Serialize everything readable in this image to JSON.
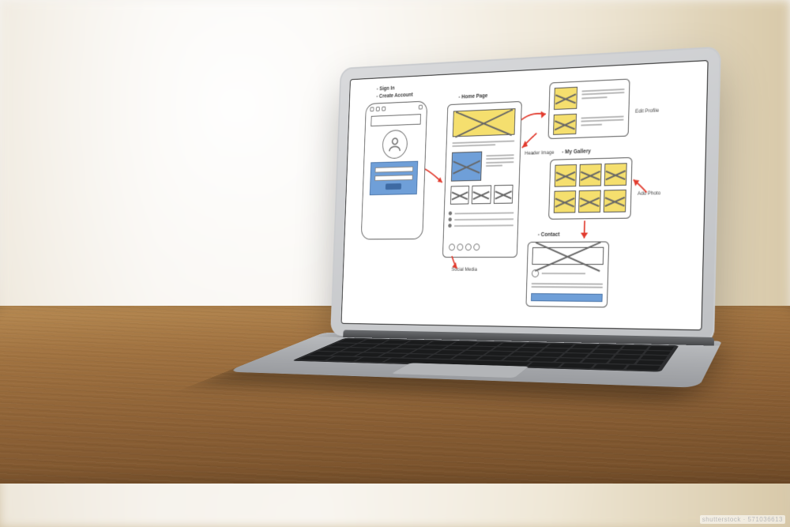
{
  "watermark": "shutterstock · 571036613",
  "wireframe": {
    "signin": {
      "title_line1": "- Sign In",
      "title_line2": "- Create Account"
    },
    "home": {
      "title": "- Home Page",
      "header_annotation": "Header Image",
      "social_annotation": "Social Media"
    },
    "profile": {
      "title": "Edit Profile"
    },
    "gallery": {
      "title": "- My Gallery",
      "add_photo": "Add Photo"
    },
    "contact": {
      "title": "- Contact"
    }
  }
}
